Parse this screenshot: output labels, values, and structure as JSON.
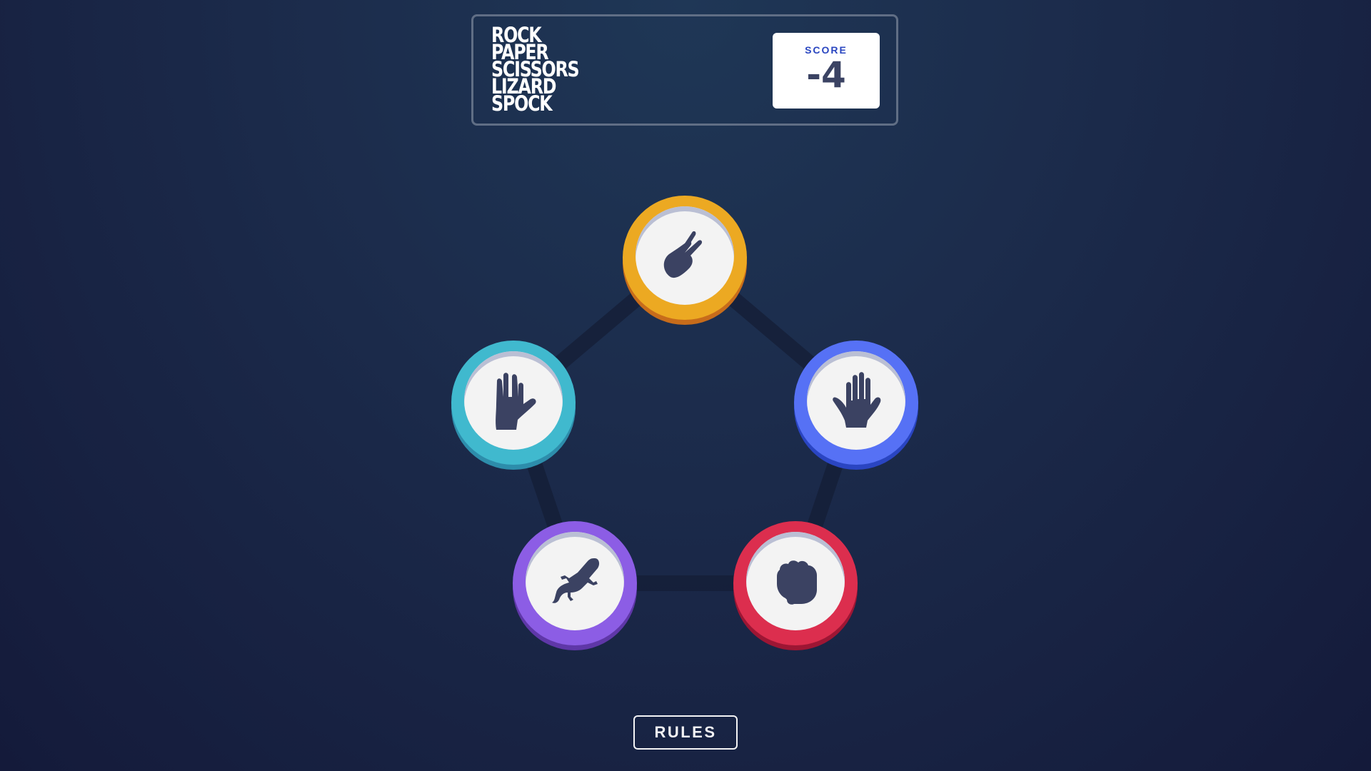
{
  "header": {
    "title_lines": [
      "ROCK",
      "PAPER",
      "SCISSORS",
      "LIZARD",
      "SPOCK"
    ],
    "score_label": "SCORE",
    "score_value": "-4"
  },
  "tokens": [
    {
      "id": "scissors",
      "color": "#eca922",
      "icon": "scissors-hand-icon"
    },
    {
      "id": "paper",
      "color": "#5671f5",
      "icon": "paper-hand-icon"
    },
    {
      "id": "rock",
      "color": "#dc2e4e",
      "icon": "rock-fist-icon"
    },
    {
      "id": "lizard",
      "color": "#8c5de5",
      "icon": "lizard-icon"
    },
    {
      "id": "spock",
      "color": "#40b9ce",
      "icon": "spock-hand-icon"
    }
  ],
  "footer": {
    "rules_label": "RULES"
  }
}
